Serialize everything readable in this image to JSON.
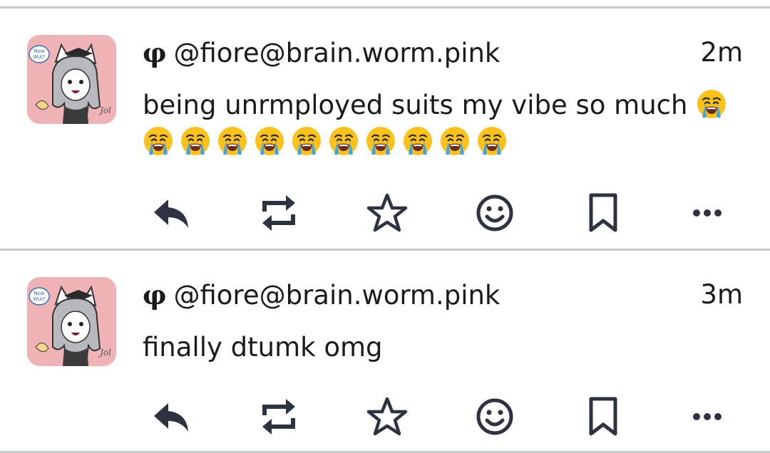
{
  "posts": [
    {
      "author_glyph": "φ",
      "author_handle": "@fiore@brain.worm.pink",
      "time": "2m",
      "text": "being unrmployed suits my vibe so much",
      "emoji_name": "loudly-crying-face",
      "emoji_count": 11
    },
    {
      "author_glyph": "φ",
      "author_handle": "@fiore@brain.worm.pink",
      "time": "3m",
      "text": "finally dtumk omg"
    }
  ],
  "avatar": {
    "bubble_text": "Now Wut?",
    "background": "#efb3b5"
  },
  "actions": [
    {
      "name": "reply-icon"
    },
    {
      "name": "boost-icon"
    },
    {
      "name": "favourite-icon"
    },
    {
      "name": "emoji-reaction-icon"
    },
    {
      "name": "bookmark-icon"
    },
    {
      "name": "more-icon"
    }
  ],
  "colors": {
    "icon": "#2e3341",
    "divider": "#c6c9cf",
    "text": "#1a1a1f"
  }
}
